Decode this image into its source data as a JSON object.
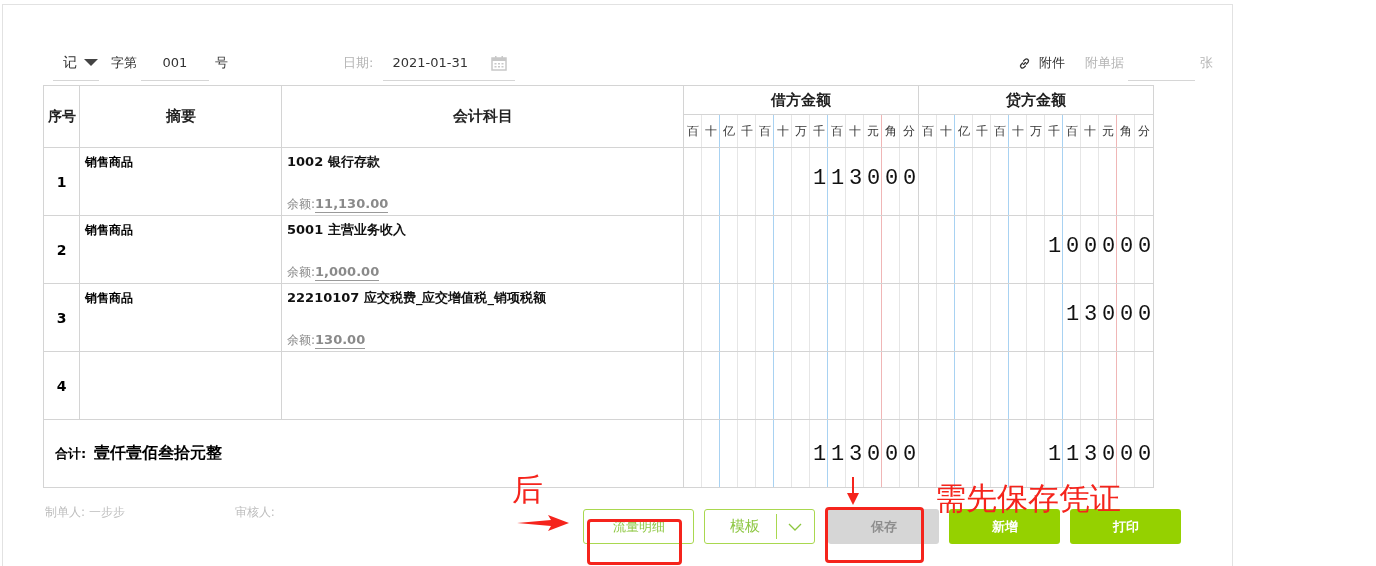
{
  "header": {
    "voucher_type": "记",
    "word_label": "字第",
    "voucher_no": "001",
    "no_suffix": "号",
    "date_label": "日期:",
    "date": "2021-01-31",
    "attachment_link": "附件",
    "attach_label": "附单据",
    "attach_unit": "张"
  },
  "table": {
    "columns": {
      "seq": "序号",
      "summary": "摘要",
      "account": "会计科目",
      "debit": "借方金额",
      "credit": "贷方金额"
    },
    "debit_units": [
      "百",
      "十",
      "亿",
      "千",
      "百",
      "十",
      "万",
      "千",
      "百",
      "十",
      "元",
      "角",
      "分"
    ],
    "credit_units": [
      "百",
      "十",
      "亿",
      "千",
      "百",
      "十",
      "万",
      "千",
      "百",
      "十",
      "元",
      "角",
      "分"
    ],
    "rows": [
      {
        "seq": "1",
        "summary": "销售商品",
        "account": "1002 银行存款",
        "balance_label": "余额:",
        "balance": "11,130.00",
        "debit": "113000",
        "credit": ""
      },
      {
        "seq": "2",
        "summary": "销售商品",
        "account": "5001 主营业务收入",
        "balance_label": "余额:",
        "balance": "1,000.00",
        "debit": "",
        "credit": "100000"
      },
      {
        "seq": "3",
        "summary": "销售商品",
        "account": "22210107 应交税费_应交增值税_销项税额",
        "balance_label": "余额:",
        "balance": "130.00",
        "debit": "",
        "credit": "13000"
      },
      {
        "seq": "4",
        "summary": "",
        "account": "",
        "balance_label": "",
        "balance": "",
        "debit": "",
        "credit": ""
      }
    ],
    "total": {
      "label": "合计:",
      "words": "壹仟壹佰叁拾元整",
      "debit": "113000",
      "credit": "113000"
    }
  },
  "footer": {
    "maker_label": "制单人:",
    "maker": "一步步",
    "reviewer_label": "审核人:"
  },
  "buttons": [
    {
      "kind": "outline",
      "label": "流量明细",
      "disabled": false
    },
    {
      "kind": "split",
      "label": "模板",
      "disabled": false
    },
    {
      "kind": "primary",
      "label": "保存",
      "disabled": true
    },
    {
      "kind": "primary",
      "label": "新增",
      "disabled": false
    },
    {
      "kind": "primary",
      "label": "打印",
      "disabled": false
    }
  ],
  "annotations": [
    {
      "kind": "text",
      "text": "后"
    },
    {
      "kind": "arrow_right"
    },
    {
      "kind": "box"
    },
    {
      "kind": "arrow_down"
    },
    {
      "kind": "box"
    },
    {
      "kind": "text",
      "text": "需先保存凭证"
    }
  ]
}
